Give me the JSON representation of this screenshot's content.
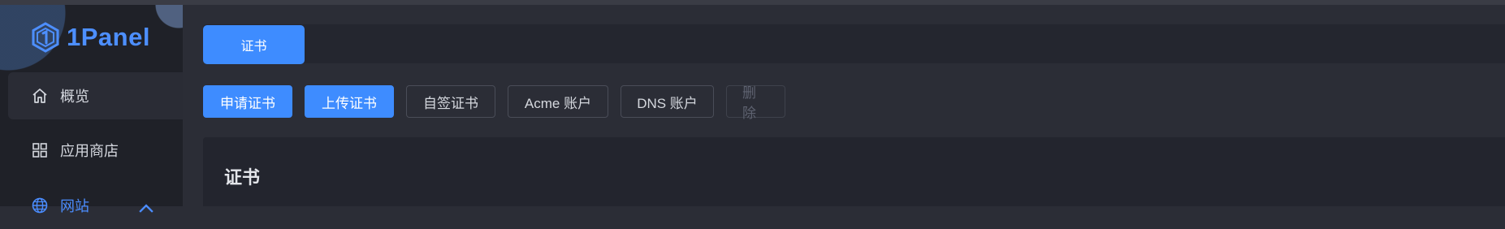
{
  "app": {
    "logo_text": "1Panel",
    "accent": "#3e8cff"
  },
  "sidebar": {
    "items": [
      {
        "label": "概览",
        "icon": "home-icon"
      },
      {
        "label": "应用商店",
        "icon": "grid-icon"
      },
      {
        "label": "网站",
        "icon": "globe-icon",
        "expanded": true
      }
    ]
  },
  "tabs": [
    {
      "label": "证书",
      "active": true
    }
  ],
  "toolbar": {
    "buttons": [
      {
        "label": "申请证书",
        "style": "primary"
      },
      {
        "label": "上传证书",
        "style": "primary"
      },
      {
        "label": "自签证书",
        "style": "default"
      },
      {
        "label": "Acme 账户",
        "style": "default"
      },
      {
        "label": "DNS 账户",
        "style": "default"
      },
      {
        "label": "删除",
        "style": "disabled"
      }
    ]
  },
  "card": {
    "title": "证书"
  }
}
